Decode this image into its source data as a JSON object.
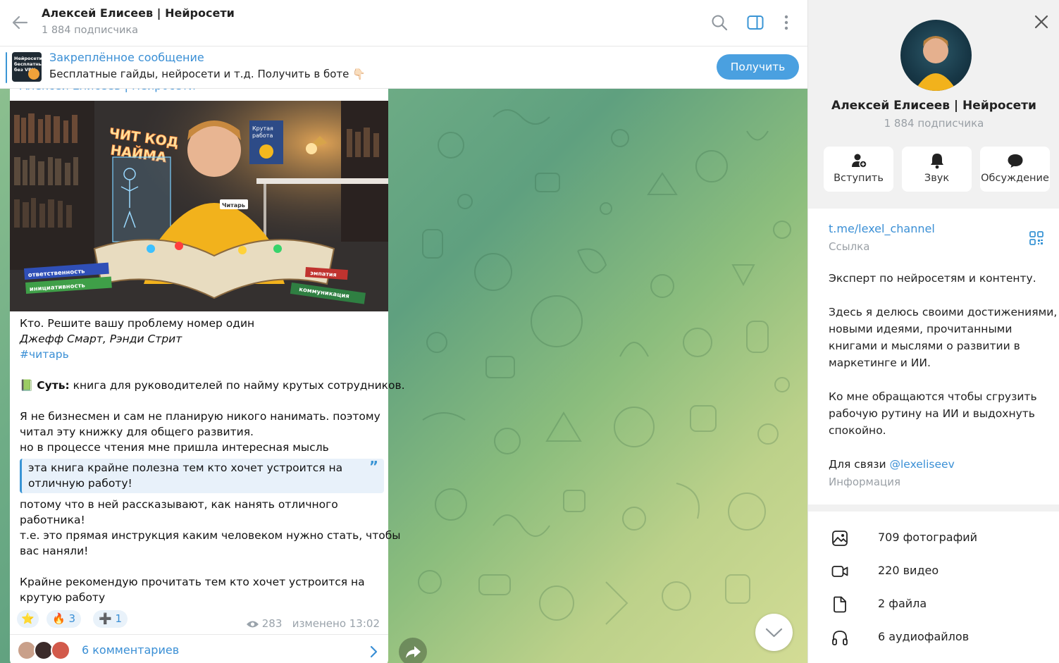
{
  "header": {
    "title": "Алексей Елисеев | Нейросети",
    "subscribers": "1 884 подписчика"
  },
  "pinned": {
    "title": "Закреплённое сообщение",
    "text": "Бесплатные гайды, нейросети и т.д. Получить в боте 👇🏻",
    "thumb_text": "Нейросети бесплатные без VPN",
    "button_label": "Получить"
  },
  "message": {
    "sender": "Алексей Елисеев | Нейросети",
    "photo_text": {
      "neon_sign": "ЧИТ КОД НАЙМА",
      "poster": "Крутая работа",
      "badge": "Читарь",
      "floor_1": "ответственность",
      "floor_2": "инициативность",
      "floor_3": "коммуникация",
      "floor_4": "эмпатия"
    },
    "book_title": "Кто. Решите вашу проблему номер один",
    "authors": "Джефф Смарт, Рэнди Стрит",
    "hashtag": "#читарь",
    "essence_icon": "📗",
    "essence_label": "Суть:",
    "essence_text": " книга для руководителей по найму крутых сотрудников.",
    "para1_line1": "Я не бизнесмен и сам не планирую никого нанимать. поэтому",
    "para1_line2": "читал эту книжку для общего развития.",
    "para1_line3": "но в процессе чтения мне пришла интересная мысль",
    "quote_line1": "эта книга крайне полезна тем кто хочет устроится на",
    "quote_line2": "отличную работу!",
    "para2_line1": "потому что в ней рассказывают, как нанять отличного",
    "para2_line2": "работника!",
    "para2_line3": "т.е. это прямая инструкция каким человеком нужно стать, чтобы",
    "para2_line4": "вас наняли!",
    "para3_line1": "Крайне рекомендую прочитать тем кто хочет устроится на",
    "para3_line2": "крутую работу",
    "reactions": [
      {
        "emoji": "⭐",
        "count": ""
      },
      {
        "emoji": "🔥",
        "count": "3"
      },
      {
        "emoji": "➕",
        "count": "1"
      }
    ],
    "views": "283",
    "edited_time": "изменено 13:02",
    "comments_label": "6 комментариев"
  },
  "info_panel": {
    "name": "Алексей Елисеев | Нейросети",
    "subscribers": "1 884 подписчика",
    "actions": [
      {
        "label": "Вступить",
        "icon": "add-user-icon"
      },
      {
        "label": "Звук",
        "icon": "bell-icon"
      },
      {
        "label": "Обсуждение",
        "icon": "chat-bubble-icon"
      }
    ],
    "link": "t.me/lexel_channel",
    "link_caption": "Ссылка",
    "about": {
      "line1": "Эксперт по нейросетям и контенту.",
      "line2": "Здесь я делюсь своими достижениями,",
      "line3": "новыми идеями, прочитанными",
      "line4": "книгами и мыслями о развитии в",
      "line5": "маркетинге и ИИ.",
      "line6": "Ко мне обращаются чтобы сгрузить",
      "line7": "рабочую рутину на ИИ и выдохнуть",
      "line8": "спокойно.",
      "contact_prefix": "Для связи ",
      "contact_mention": "@lexeliseev"
    },
    "about_caption": "Информация",
    "media": [
      {
        "label": "709 фотографий",
        "icon": "photo-icon"
      },
      {
        "label": "220 видео",
        "icon": "video-icon"
      },
      {
        "label": "2 файла",
        "icon": "file-icon"
      },
      {
        "label": "6 аудиофайлов",
        "icon": "headphones-icon"
      }
    ]
  },
  "colors": {
    "accent": "#3a8fd5",
    "button": "#4aa0e0",
    "quote_bg": "#e8f1fa",
    "wallpaper_from": "#6fad86",
    "wallpaper_to": "#d3dc95"
  }
}
